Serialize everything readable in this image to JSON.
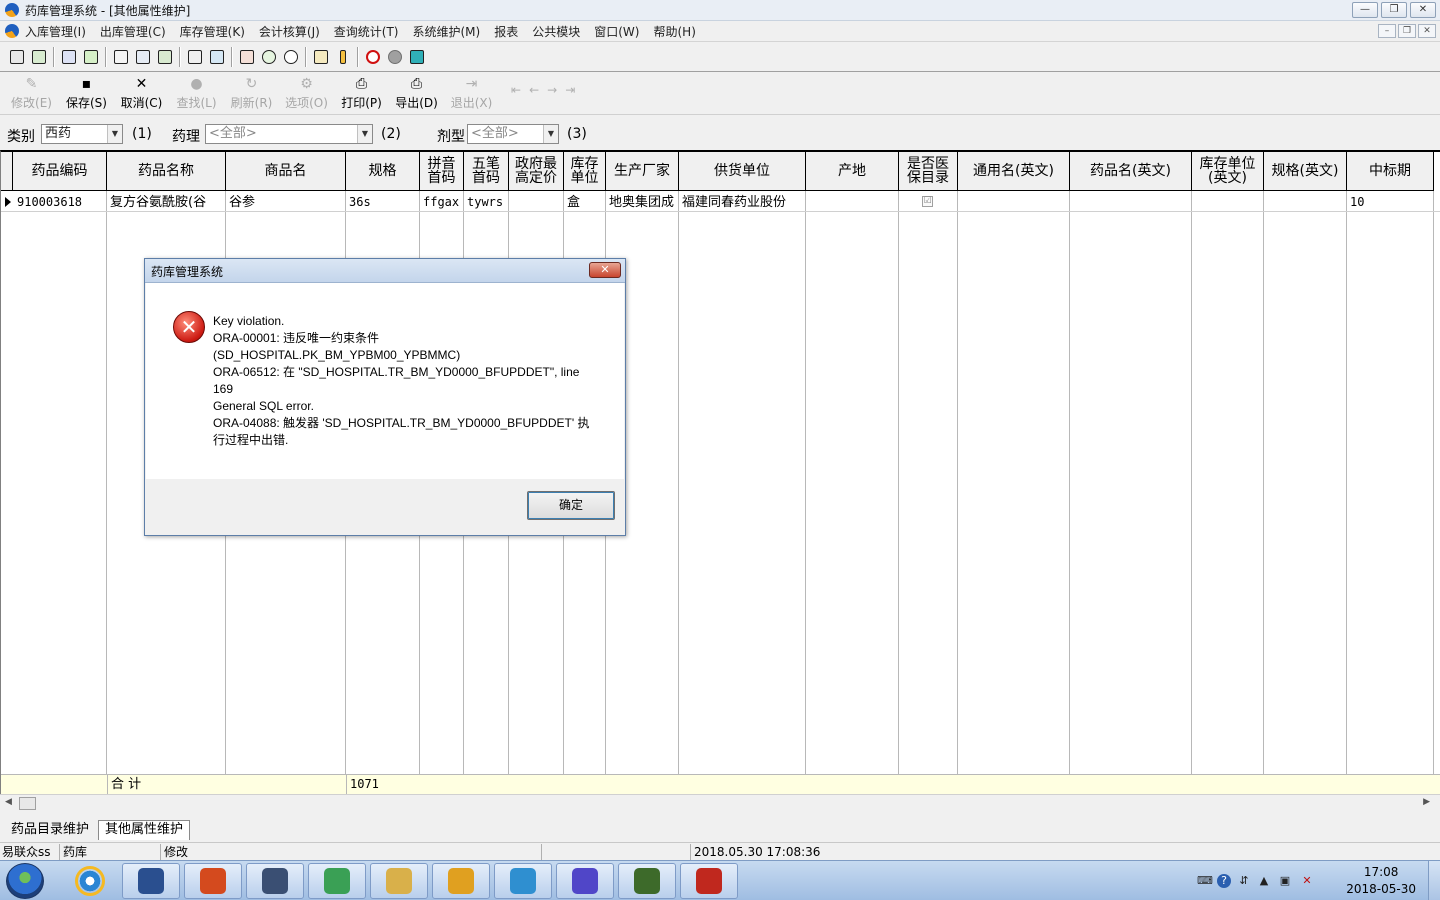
{
  "window": {
    "title": "药库管理系统 - [其他属性维护]",
    "controls": [
      "—",
      "❐",
      "✕"
    ]
  },
  "menu": {
    "items": [
      "入库管理(I)",
      "出库管理(C)",
      "库存管理(K)",
      "会计核算(J)",
      "查询统计(T)",
      "系统维护(M)",
      "报表",
      "公共模块",
      "窗口(W)",
      "帮助(H)"
    ],
    "mdi_controls": [
      "–",
      "❐",
      "✕"
    ]
  },
  "toolbar2": {
    "buttons": [
      {
        "label": "修改(E)",
        "icon": "edit-icon",
        "glyph": "✎",
        "enabled": false
      },
      {
        "label": "保存(S)",
        "icon": "save-icon",
        "glyph": "▪",
        "enabled": true
      },
      {
        "label": "取消(C)",
        "icon": "cancel-icon",
        "glyph": "✕",
        "enabled": true
      },
      {
        "label": "查找(L)",
        "icon": "find-icon",
        "glyph": "●",
        "enabled": false
      },
      {
        "label": "刷新(R)",
        "icon": "refresh-icon",
        "glyph": "↻",
        "enabled": false
      },
      {
        "label": "选项(O)",
        "icon": "options-icon",
        "glyph": "⚙",
        "enabled": false
      },
      {
        "label": "打印(P)",
        "icon": "print-icon",
        "glyph": "⎙",
        "enabled": true
      },
      {
        "label": "导出(D)",
        "icon": "export-icon",
        "glyph": "⎙",
        "enabled": true
      },
      {
        "label": "退出(X)",
        "icon": "exit-icon",
        "glyph": "⇥",
        "enabled": false
      }
    ],
    "nav": [
      "⇤",
      "←",
      "→",
      "⇥"
    ]
  },
  "filters": {
    "category_label": "类别",
    "category_value": "西药",
    "category_hotkey": "(1)",
    "pharmacology_label": "药理",
    "pharmacology_value": "<全部>",
    "pharmacology_hotkey": "(2)",
    "dosage_label": "剂型",
    "dosage_value": "<全部>",
    "dosage_hotkey": "(3)"
  },
  "grid": {
    "columns": [
      "药品编码",
      "药品名称",
      "商品名",
      "规格",
      "拼音\n首码",
      "五笔\n首码",
      "政府最\n高定价",
      "库存\n单位",
      "生产厂家",
      "供货单位",
      "产地",
      "是否医\n保目录",
      "通用名(英文)",
      "药品名(英文)",
      "库存单位\n(英文)",
      "规格(英文)",
      "中标期"
    ],
    "row": {
      "code": "910003618",
      "name": "复方谷氨酰胺(谷",
      "trade_name": "谷参",
      "spec": "36s",
      "pinyin": "ffgax",
      "wubi": "tywrs",
      "gov_price": "",
      "unit": "盒",
      "manufacturer": "地奥集团成",
      "supplier": "福建同春药业股份",
      "origin": "",
      "insurance_check": "☑",
      "bid_period": "10"
    },
    "totals": {
      "label": "合  计",
      "spec_total": "1071"
    }
  },
  "tabs": [
    "药品目录维护",
    "其他属性维护"
  ],
  "active_tab": 1,
  "status": {
    "user": "易联众ss",
    "dept": "药库",
    "mode": "修改",
    "datetime": "2018.05.30 17:08:36"
  },
  "dialog": {
    "title": "药库管理系统",
    "close": "✕",
    "icon_glyph": "✕",
    "lines": [
      "Key violation.",
      "ORA-00001: 违反唯一约束条件",
      "(SD_HOSPITAL.PK_BM_YPBM00_YPBMMC)",
      "ORA-06512: 在 \"SD_HOSPITAL.TR_BM_YD0000_BFUPDDET\", line",
      "169",
      "General SQL error.",
      "ORA-04088: 触发器 'SD_HOSPITAL.TR_BM_YD0000_BFUPDDET' 执",
      "行过程中出错."
    ],
    "ok_label": "确定"
  },
  "taskbar": {
    "clock_time": "17:08",
    "clock_date": "2018-05-30",
    "app_colors": [
      "#2a4f8f",
      "#d44a1e",
      "#3a4f73",
      "#3aa055",
      "#d9b04a",
      "#e0a020",
      "#2f8fd0",
      "#5046c8",
      "#3d6a2a",
      "#c0281e"
    ]
  },
  "colors": {
    "dialog_error": "#cc1a12",
    "totals_row": "#ffffe1"
  }
}
